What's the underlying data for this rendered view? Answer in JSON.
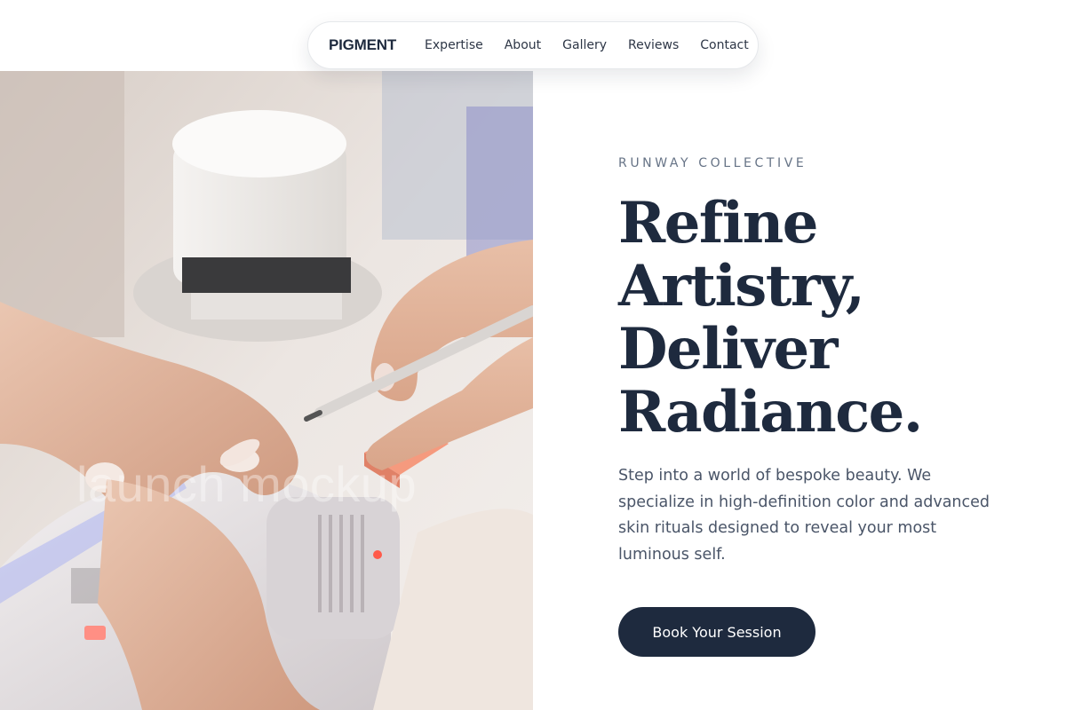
{
  "nav": {
    "logo": "PIGMENT",
    "links": [
      "Expertise",
      "About",
      "Gallery",
      "Reviews",
      "Contact"
    ]
  },
  "hero": {
    "image_watermark": "launch mockup",
    "eyebrow": "RUNWAY COLLECTIVE",
    "headline_lines": [
      "Refine",
      "Artistry,",
      "Deliver",
      "Radiance."
    ],
    "description": "Step into a world of bespoke beauty. We specialize in high-definition color and advanced skin rituals designed to reveal your most luminous self.",
    "cta_label": "Book Your Session"
  },
  "colors": {
    "brand_navy": "#1e2a3e",
    "muted_text": "#667386",
    "body_text": "#4a5568",
    "background": "#ffffff"
  }
}
